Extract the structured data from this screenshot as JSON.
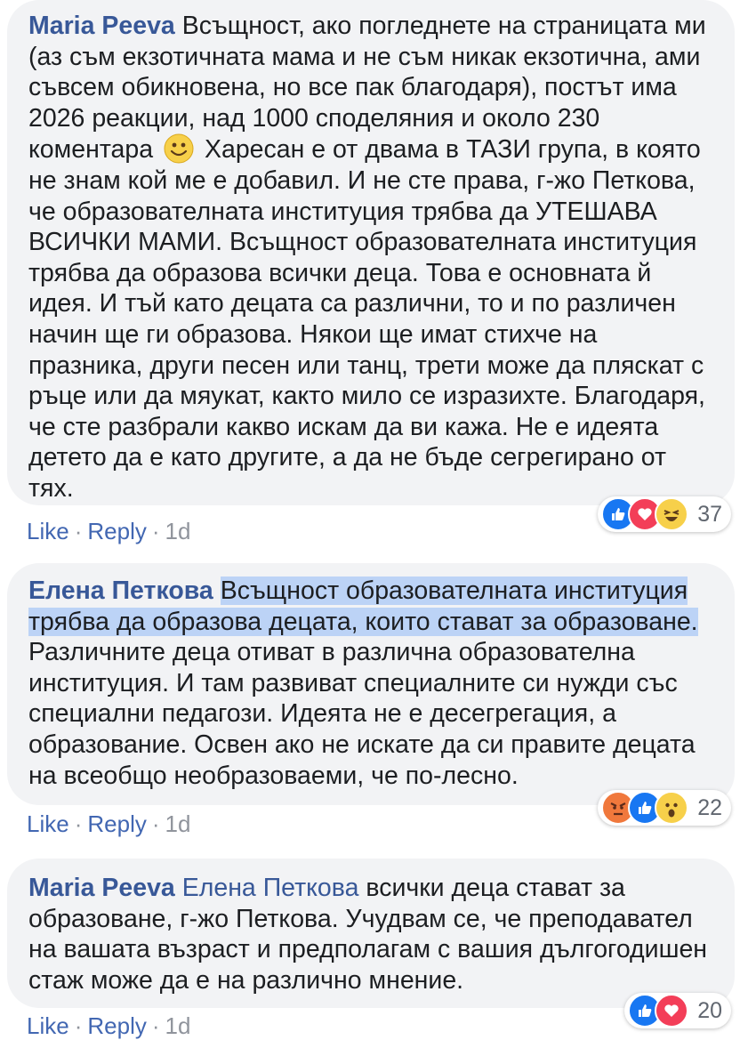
{
  "comments": [
    {
      "author": "Maria Peeva",
      "text_a": "Всъщност, ако погледнете на страницата ми (аз съм екзотичната мама и не съм никак екзотична, ами съвсем обикновена, но все пак благодаря), постът има 2026 реакции, над 1000 споделяния и около 230 коментара",
      "text_b": "Харесан е от двама в ТАЗИ група, в която не знам кой ме е добавил. И не сте права, г-жо Петкова, че образователната институция трябва да УТЕШАВА ВСИЧКИ МАМИ. Всъщност образователната институция трябва да образова всички деца. Това е основната й идея. И тъй като децата са различни, то и по различен начин ще ги образова. Някои ще имат стихче на празника, други песен или танц, трети може да пляскат с ръце или да мяукат, както мило се изразихте. Благодаря, че сте разбрали какво искам да ви кажа. Не е идеята детето да е като другите, а да не бъде сегрегирано от тях.",
      "like": "Like",
      "reply": "Reply",
      "time": "1d",
      "reactions": [
        "like-icon",
        "love-icon",
        "haha-icon"
      ],
      "reaction_count": "37"
    },
    {
      "author": "Елена Петкова",
      "highlighted": "Всъщност образователната институция трябва да образова децата, които стават за образоване.",
      "text": "Различните деца отиват в различна образователна институция. И там развиват специалните си нужди със специални педагози. Идеята не е десегрегация, а образование. Освен ако не искате да си правите децата на всеобщо необразоваеми, че по-лесно.",
      "like": "Like",
      "reply": "Reply",
      "time": "1d",
      "reactions": [
        "angry-icon",
        "like-icon",
        "wow-icon"
      ],
      "reaction_count": "22"
    },
    {
      "author": "Maria Peeva",
      "mention": "Елена Петкова",
      "text": "всички деца стават за образоване, г-жо Петкова. Учудвам се, че преподавател на вашата възраст и предполагам с вашия дългогодишен стаж може да е на различно мнение.",
      "like": "Like",
      "reply": "Reply",
      "time": "1d",
      "reactions": [
        "like-icon",
        "love-icon"
      ],
      "reaction_count": "20"
    }
  ],
  "colors": {
    "author": "#385898",
    "bubble": "#f2f3f5",
    "highlight": "#bcd3f6",
    "link": "#4267b2",
    "meta": "#90949c"
  }
}
